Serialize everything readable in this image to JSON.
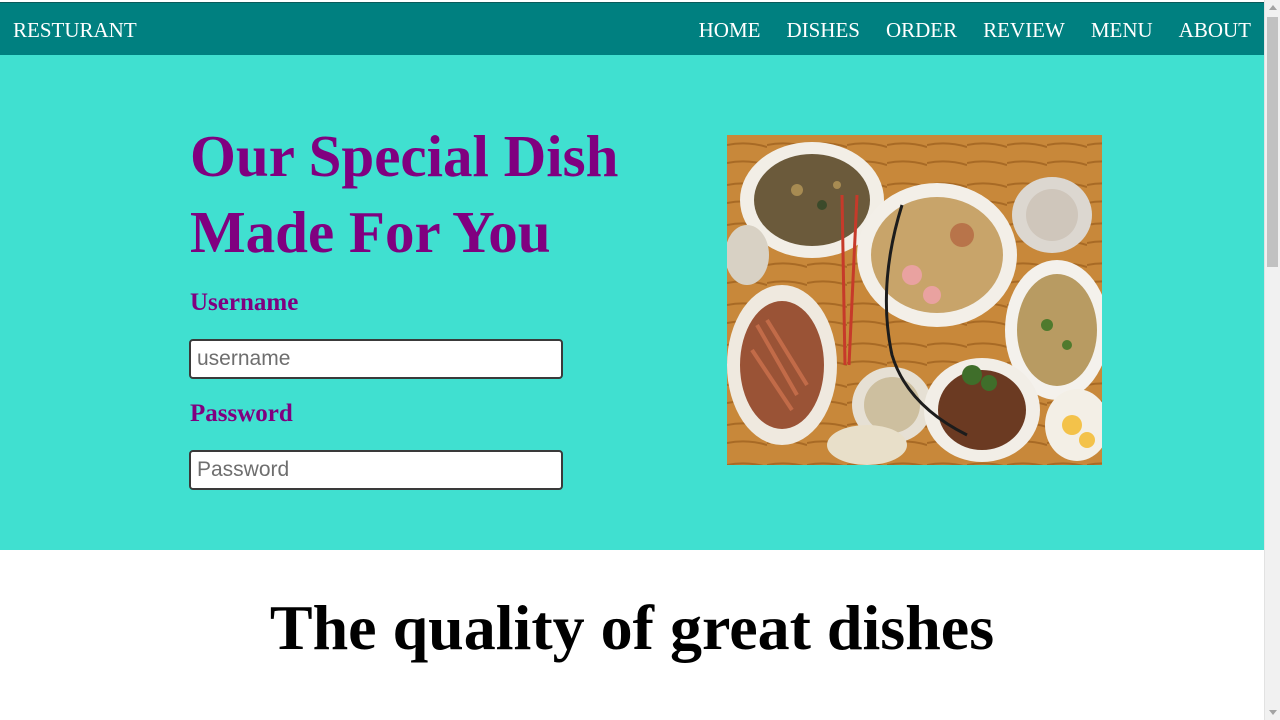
{
  "navbar": {
    "brand": "RESTURANT",
    "links": [
      "HOME",
      "DISHES",
      "ORDER",
      "REVIEW",
      "MENU",
      "ABOUT"
    ],
    "background": "#008080"
  },
  "hero": {
    "title": "Our Special Dish Made For You",
    "background": "#40e0d0",
    "accent": "#800080",
    "username_label": "Username",
    "username_placeholder": "username",
    "password_label": "Password",
    "password_placeholder": "Password"
  },
  "quality": {
    "title": "The quality of great dishes"
  }
}
